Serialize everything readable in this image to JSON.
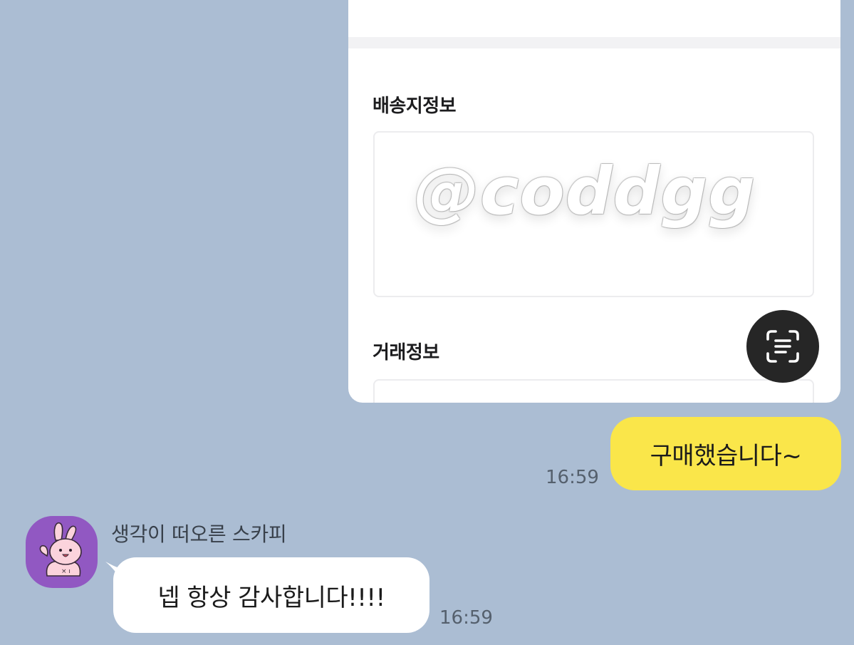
{
  "shared_image": {
    "shipping_section_title": "배송지정보",
    "trade_section_title": "거래정보",
    "watermark_text": "@coddgg",
    "scan_button_icon": "text-scan-icon"
  },
  "messages": [
    {
      "direction": "outgoing",
      "text": "구매했습니다~",
      "time": "16:59"
    },
    {
      "direction": "incoming",
      "sender": "생각이 떠오른 스카피",
      "avatar_icon": "pink-rabbit-avatar",
      "text": "넵 항상 감사합니다!!!!",
      "time": "16:59"
    }
  ],
  "colors": {
    "chat_background": "#abbdd3",
    "outgoing_bubble": "#fae64a",
    "incoming_bubble": "#ffffff",
    "avatar_background": "#9158c2",
    "scan_button": "#262626"
  }
}
